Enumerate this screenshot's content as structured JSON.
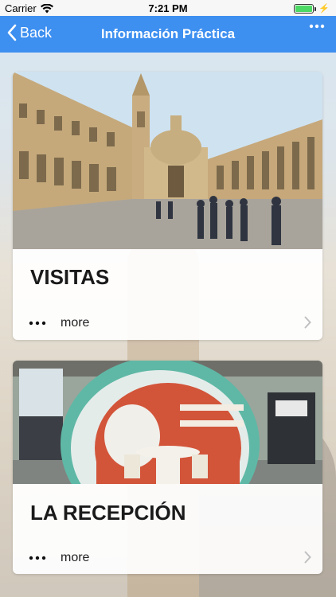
{
  "status_bar": {
    "carrier": "Carrier",
    "time": "7:21 PM",
    "wifi_icon": "wifi-icon",
    "battery_icon": "battery-icon"
  },
  "nav_bar": {
    "back_label": "Back",
    "title": "Información Práctica",
    "menu_icon": "more-dots-icon"
  },
  "cards": [
    {
      "title": "VISITAS",
      "more_label": "more",
      "image": "plaza-building-photo"
    },
    {
      "title": "LA RECEPCIÓN",
      "more_label": "more",
      "image": "reception-interior-photo"
    }
  ],
  "colors": {
    "nav_bar": "#3d8ff0",
    "battery": "#4cd964"
  }
}
